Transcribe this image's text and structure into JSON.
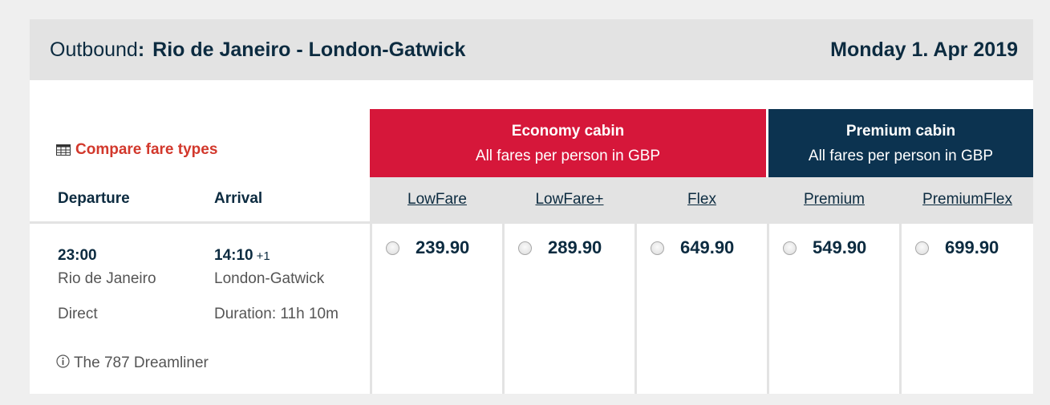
{
  "header": {
    "direction_label": "Outbound",
    "colon": ":",
    "route": "Rio de Janeiro - London-Gatwick",
    "date": "Monday 1. Apr 2019"
  },
  "compare": {
    "label": "Compare fare types",
    "icon": "table-grid-icon"
  },
  "columns": {
    "departure": "Departure",
    "arrival": "Arrival"
  },
  "cabins": [
    {
      "name": "Economy cabin",
      "subtitle": "All fares per person in GBP",
      "color": "#d6173a"
    },
    {
      "name": "Premium cabin",
      "subtitle": "All fares per person in GBP",
      "color": "#0c3350"
    }
  ],
  "fare_types": [
    "LowFare",
    "LowFare+",
    "Flex",
    "Premium",
    "PremiumFlex"
  ],
  "flight": {
    "departure_time": "23:00",
    "departure_city": "Rio de Janeiro",
    "arrival_time": "14:10",
    "arrival_day_offset": "+1",
    "arrival_city": "London-Gatwick",
    "stops": "Direct",
    "duration": "Duration: 11h 10m",
    "aircraft": "The 787 Dreamliner",
    "aircraft_icon": "info-icon",
    "prices": [
      "239.90",
      "289.90",
      "649.90",
      "549.90",
      "699.90"
    ]
  }
}
